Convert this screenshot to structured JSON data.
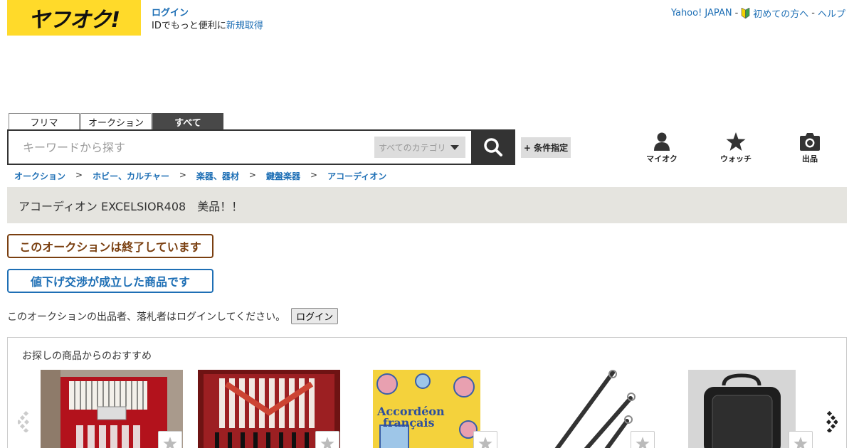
{
  "header": {
    "logo": "ヤフオク!",
    "login_link": "ログイン",
    "login_text": "IDでもっと便利に",
    "register_link": "新規取得",
    "top_links": [
      "Yahoo! JAPAN",
      "初めての方へ",
      "ヘルプ"
    ]
  },
  "search": {
    "tabs": [
      "フリマ",
      "オークション",
      "すべて"
    ],
    "active_tab": "すべて",
    "placeholder": "キーワードから探す",
    "category": "すべてのカテゴリ",
    "condition_button": "+ 条件指定"
  },
  "quick_links": [
    "マイオク",
    "ウォッチ",
    "出品"
  ],
  "breadcrumb": [
    "オークション",
    "ホビー、カルチャー",
    "楽器、器材",
    "鍵盤楽器",
    "アコーディオン"
  ],
  "item": {
    "title": "アコーディオン EXCELSIOR408　美品！！",
    "ended_label": "このオークションは終了しています",
    "negotiated_label": "値下げ交渉が成立した商品です",
    "login_note": "このオークションの出品者、落札者はログインしてください。",
    "login_button": "ログイン"
  },
  "recommendations": {
    "title": "お探しの商品からのおすすめ",
    "items": [
      {
        "icon": "accordion-red-image"
      },
      {
        "icon": "accordion-red-pearl-image"
      },
      {
        "icon": "accordeon-francais-book-image",
        "text1": "Accordéon",
        "text2": "français"
      },
      {
        "icon": "accordion-strap-image"
      },
      {
        "icon": "accordion-bag-image"
      }
    ]
  },
  "colors": {
    "brand_yellow": "#ffda2a",
    "link_blue": "#1e6fb5",
    "ended_brown": "#7a3f10",
    "title_bg": "#e5e4df"
  }
}
